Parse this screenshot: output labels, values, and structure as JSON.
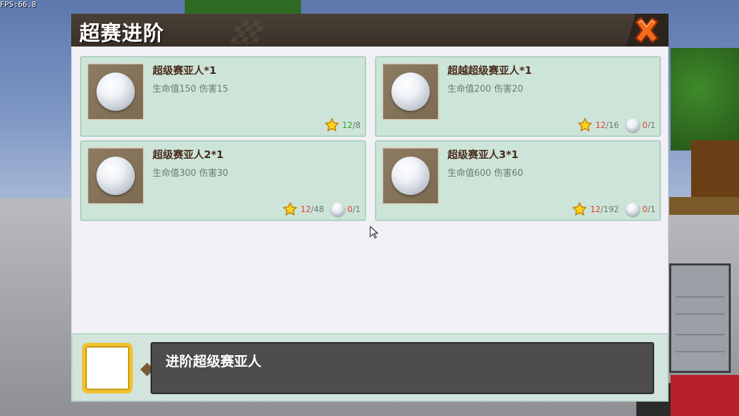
{
  "hud": {
    "fps": "FPS:66.8"
  },
  "dialog": {
    "title": "超赛进阶",
    "close_icon": "close-x-icon",
    "accent_color": "#f26a1b",
    "cards": [
      {
        "name": "超级赛亚人*1",
        "stats": "生命值150 伤害15",
        "star_have": "12",
        "star_need": "/8",
        "star_ok": true,
        "orb": null
      },
      {
        "name": "超越超级赛亚人*1",
        "stats": "生命值200 伤害20",
        "star_have": "12",
        "star_need": "/16",
        "star_ok": false,
        "orb": {
          "have": "0",
          "need": "/1"
        }
      },
      {
        "name": "超级赛亚人2*1",
        "stats": "生命值300 伤害30",
        "star_have": "12",
        "star_need": "/48",
        "star_ok": false,
        "orb": {
          "have": "0",
          "need": "/1"
        }
      },
      {
        "name": "超级赛亚人3*1",
        "stats": "生命值600 伤害60",
        "star_have": "12",
        "star_need": "/192",
        "star_ok": false,
        "orb": {
          "have": "0",
          "need": "/1"
        }
      }
    ],
    "footer": {
      "description": "进阶超级赛亚人"
    }
  }
}
